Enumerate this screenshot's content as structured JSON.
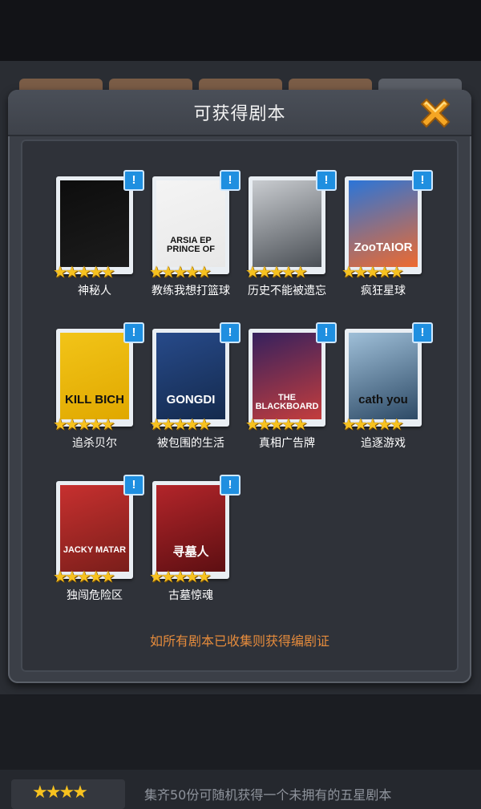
{
  "dialog": {
    "title": "可获得剧本",
    "footer_note": "如所有剧本已收集则获得编剧证"
  },
  "badge_symbol": "!",
  "scripts": [
    {
      "name": "神秘人",
      "stars": "★★★★★",
      "cover_text": "",
      "cover_colors": [
        "#0d0d0d",
        "#1c1c1c"
      ]
    },
    {
      "name": "教练我想打篮球",
      "stars": "★★★★★",
      "cover_text": "ARSIA EP PRINCE OF",
      "cover_colors": [
        "#f4f4f4",
        "#e8e8e8"
      ]
    },
    {
      "name": "历史不能被遗忘",
      "stars": "★★★★★",
      "cover_text": "",
      "cover_colors": [
        "#c9ccd0",
        "#4a4f55"
      ]
    },
    {
      "name": "疯狂星球",
      "stars": "★★★★★",
      "cover_text": "ZooTAIOR",
      "cover_colors": [
        "#2b75d8",
        "#ee6a2f"
      ]
    },
    {
      "name": "追杀贝尔",
      "stars": "★★★★★",
      "cover_text": "KILL BICH",
      "cover_colors": [
        "#f2c418",
        "#e0a800"
      ]
    },
    {
      "name": "被包围的生活",
      "stars": "★★★★★",
      "cover_text": "GONGDI",
      "cover_colors": [
        "#274a8a",
        "#142a4d"
      ]
    },
    {
      "name": "真相广告牌",
      "stars": "★★★★★",
      "cover_text": "THE BLACKBOARD",
      "cover_colors": [
        "#35215e",
        "#c43d3d"
      ]
    },
    {
      "name": "追逐游戏",
      "stars": "★★★★★",
      "cover_text": "cath you",
      "cover_colors": [
        "#9fbfd8",
        "#2d4a66"
      ]
    },
    {
      "name": "独闯危险区",
      "stars": "★★★★★",
      "cover_text": "JACKY MATAR",
      "cover_colors": [
        "#c7302f",
        "#7a1e1a"
      ]
    },
    {
      "name": "古墓惊魂",
      "stars": "★★★★★",
      "cover_text": "寻墓人",
      "cover_colors": [
        "#b3252a",
        "#5d0f12"
      ]
    }
  ],
  "bottom": {
    "stars": "★★★★",
    "text": "集齐50份可随机获得一个未拥有的五星剧本"
  },
  "colors": {
    "accent_orange": "#e58b3c",
    "star_gold": "#f7c21f",
    "badge_blue": "#1f8fe0",
    "close_orange": "#f5a623"
  },
  "icons": {
    "close": "close-x-icon",
    "badge": "exclamation-icon",
    "star": "star-icon"
  }
}
